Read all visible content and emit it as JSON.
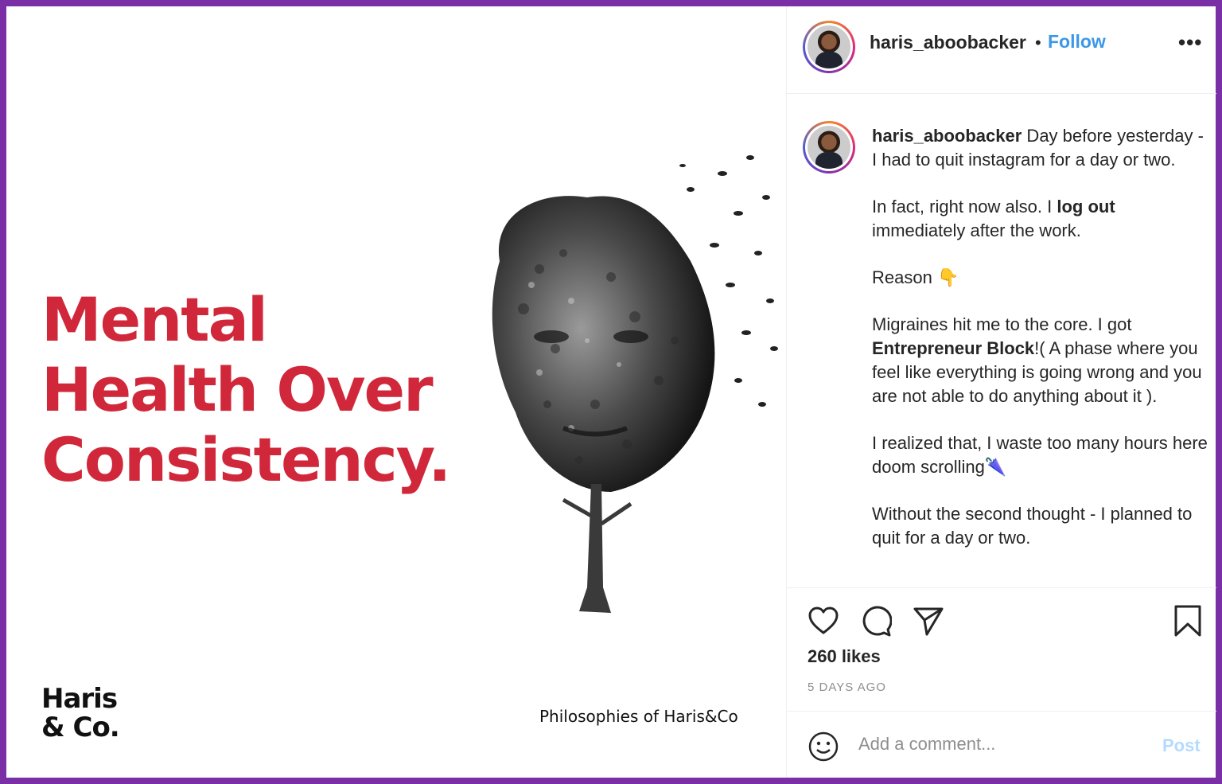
{
  "post_image": {
    "headline": [
      "Mental",
      "Health Over",
      "Consistency."
    ],
    "logo_lines": [
      "Haris",
      "& Co."
    ],
    "image_caption": "Philosophies of Haris&Co",
    "headline_color": "#d0283a"
  },
  "header": {
    "username": "haris_aboobacker",
    "separator": "•",
    "follow_label": "Follow",
    "more_label": "•••"
  },
  "caption": {
    "username": "haris_aboobacker",
    "p1_rest": " Day before yesterday - I had to quit instagram for a day or two.",
    "p2_pre": "In fact, right now also. I ",
    "p2_bold": "log out",
    "p2_post": " immediately after the work.",
    "p3": "Reason 👇",
    "p4_pre": "Migraines hit me to the core. I got ",
    "p4_bold": "Entrepreneur Block",
    "p4_post": "!( A phase where you feel like everything is going wrong and you are not able to do anything about it ).",
    "p5": "I realized that, I waste too many hours here doom scrolling🌂",
    "p6": "Without the second thought - I planned to quit for a day or two."
  },
  "actions": {
    "like_icon": "heart-icon",
    "comment_icon": "comment-icon",
    "share_icon": "paper-plane-icon",
    "save_icon": "bookmark-icon",
    "likes_label": "260 likes",
    "timestamp": "5 DAYS AGO"
  },
  "comment_bar": {
    "emoji_icon": "smiley-icon",
    "placeholder": "Add a comment...",
    "post_label": "Post"
  },
  "colors": {
    "frame_border": "#7b2fa6",
    "follow_blue": "#3b98e8",
    "post_disabled": "#b3dbff"
  }
}
